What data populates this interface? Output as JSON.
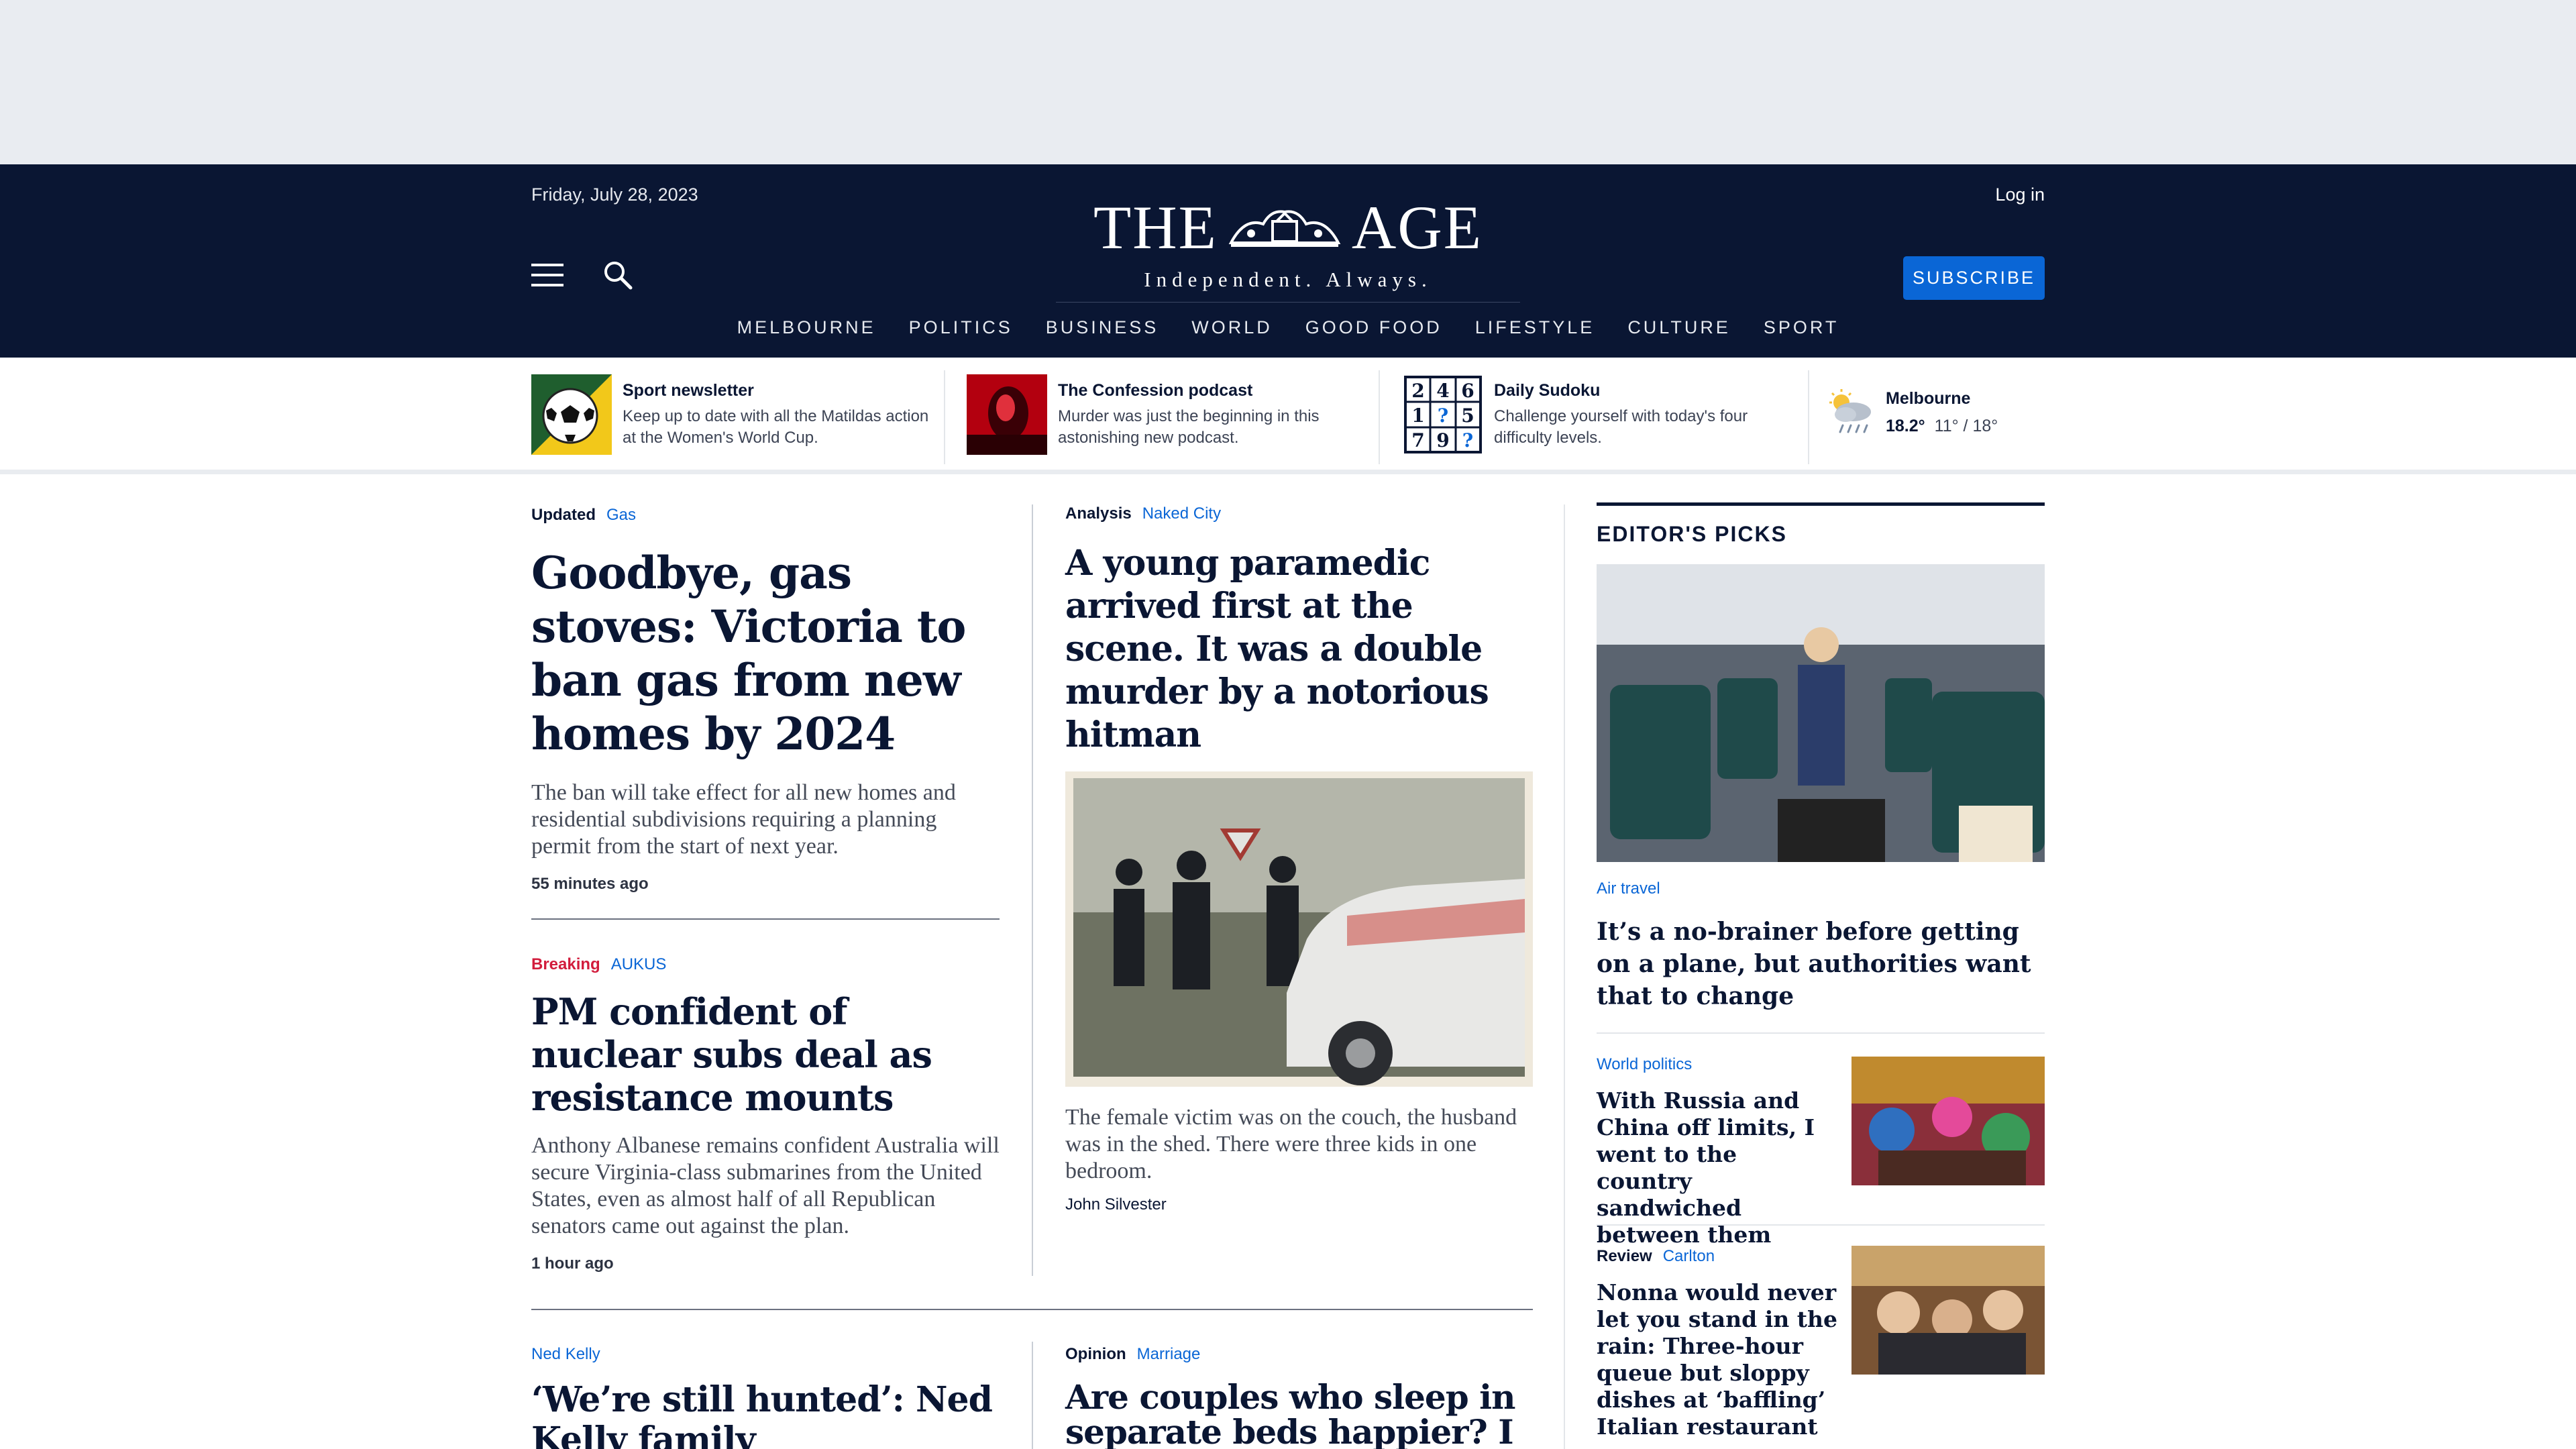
{
  "masthead": {
    "date": "Friday, July 28, 2023",
    "login": "Log in",
    "logo_left": "THE",
    "logo_right": "AGE",
    "tagline": "Independent. Always.",
    "subscribe": "SUBSCRIBE",
    "nav": [
      "MELBOURNE",
      "POLITICS",
      "BUSINESS",
      "WORLD",
      "GOOD FOOD",
      "LIFESTYLE",
      "CULTURE",
      "SPORT"
    ]
  },
  "promos": [
    {
      "title": "Sport newsletter",
      "desc": "Keep up to date with all the Matildas action at the Women's World Cup."
    },
    {
      "title": "The Confession podcast",
      "desc": "Murder was just the beginning in this astonishing new podcast."
    },
    {
      "title": "Daily Sudoku",
      "desc": "Challenge yourself with today's four difficulty levels.",
      "grid": [
        "2",
        "4",
        "6",
        "1",
        "?",
        "5",
        "7",
        "9",
        "?"
      ]
    }
  ],
  "weather": {
    "city": "Melbourne",
    "current": "18.2°",
    "range": "11° / 18°"
  },
  "stories": {
    "gas": {
      "label": "Updated",
      "tag": "Gas",
      "headline": "Goodbye, gas stoves: Victoria to ban gas from new homes by 2024",
      "standfirst": "The ban will take effect for all new homes and residential subdivisions requiring a planning permit from the start of next year.",
      "time": "55 minutes ago"
    },
    "aukus": {
      "label": "Breaking",
      "tag": "AUKUS",
      "headline": "PM confident of nuclear subs deal as resistance mounts",
      "standfirst": "Anthony Albanese remains confident Australia will secure Virginia-class submarines from the United States, even as almost half of all Republican senators came out against the plan.",
      "time": "1 hour ago"
    },
    "paramedic": {
      "label": "Analysis",
      "tag": "Naked City",
      "headline": "A young paramedic arrived first at the scene. It was a double murder by a notorious hitman",
      "standfirst": "The female victim was on the couch, the husband was in the shed. There were three kids in one bedroom.",
      "author": "John Silvester"
    },
    "nedkelly": {
      "tag": "Ned Kelly",
      "headline": "‘We’re still hunted’: Ned Kelly family descendants"
    },
    "beds": {
      "label": "Opinion",
      "tag": "Marriage",
      "headline": "Are couples who sleep in separate beds happier? I know I"
    }
  },
  "picks": {
    "title": "EDITOR'S PICKS",
    "items": [
      {
        "tag": "Air travel",
        "headline": "It’s a no-brainer before getting on a plane, but authorities want that to change"
      },
      {
        "tag": "World politics",
        "headline": "With Russia and China off limits, I went to the country sandwiched between them"
      },
      {
        "label": "Review",
        "tag": "Carlton",
        "headline": "Nonna would never let you stand in the rain: Three-hour queue but sloppy dishes at ‘baffling’ Italian restaurant"
      }
    ]
  },
  "colors": {
    "navy": "#0a1633",
    "accent_blue": "#0a66d6",
    "breaking_red": "#d21c3c"
  }
}
